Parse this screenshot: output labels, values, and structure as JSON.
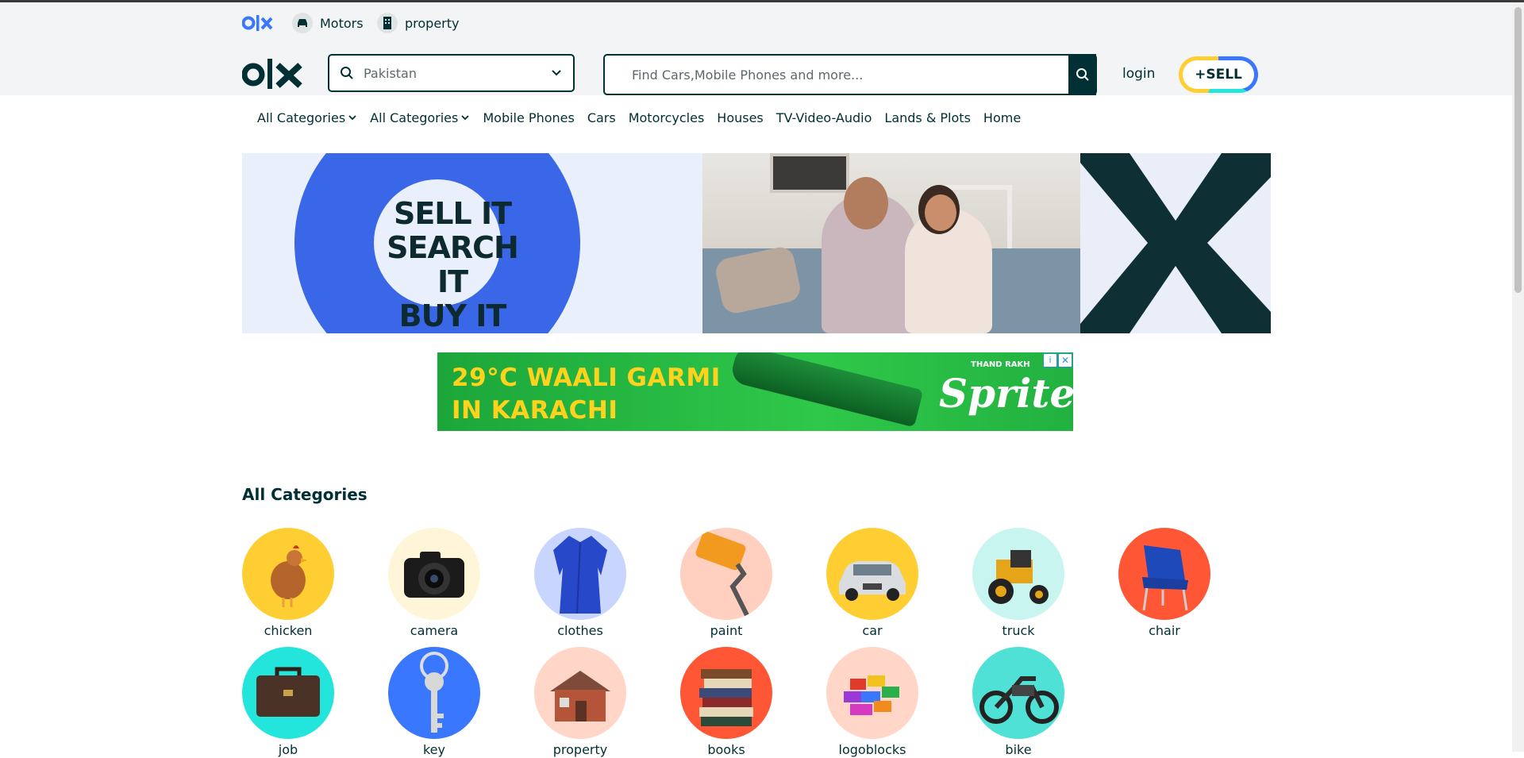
{
  "top_links": [
    {
      "label": "Motors",
      "icon": "car-icon"
    },
    {
      "label": "property",
      "icon": "building-icon"
    }
  ],
  "location": {
    "value": "Pakistan"
  },
  "search": {
    "placeholder": "Find Cars,Mobile Phones and more..."
  },
  "header": {
    "login_label": "login",
    "sell_label": "+SELL"
  },
  "nav": {
    "items": [
      "All Categories",
      "All Categories",
      "Mobile Phones",
      "Cars",
      "Motorcycles",
      "Houses",
      "TV-Video-Audio",
      "Lands & Plots",
      "Home"
    ]
  },
  "hero": {
    "line1": "SELL IT",
    "line2": "SEARCH IT",
    "line3": "BUY IT"
  },
  "ad": {
    "headline_line1": "29°C WAALI GARMI",
    "headline_line2": "IN KARACHI",
    "tagline": "THAND RAKH",
    "brand": "Sprite"
  },
  "categories": {
    "title": "All Categories",
    "items": [
      {
        "label": "chicken",
        "color": "#ffce32"
      },
      {
        "label": "camera",
        "color": "#fff6d9"
      },
      {
        "label": "clothes",
        "color": "#c8d6ff"
      },
      {
        "label": "paint",
        "color": "#ffcfc0"
      },
      {
        "label": "car",
        "color": "#ffce32"
      },
      {
        "label": "truck",
        "color": "#c8f5ef"
      },
      {
        "label": "chair",
        "color": "#ff5636"
      },
      {
        "label": "job",
        "color": "#23e5db"
      },
      {
        "label": "key",
        "color": "#3a77ff"
      },
      {
        "label": "property",
        "color": "#ffd6c8"
      },
      {
        "label": "books",
        "color": "#ff5636"
      },
      {
        "label": "logoblocks",
        "color": "#ffd6c8"
      },
      {
        "label": "bike",
        "color": "#4fe0d6"
      }
    ]
  },
  "colors": {
    "brand_dark": "#002f34",
    "accent_blue": "#3a77ff",
    "accent_yellow": "#ffce32",
    "accent_teal": "#23e5db"
  }
}
